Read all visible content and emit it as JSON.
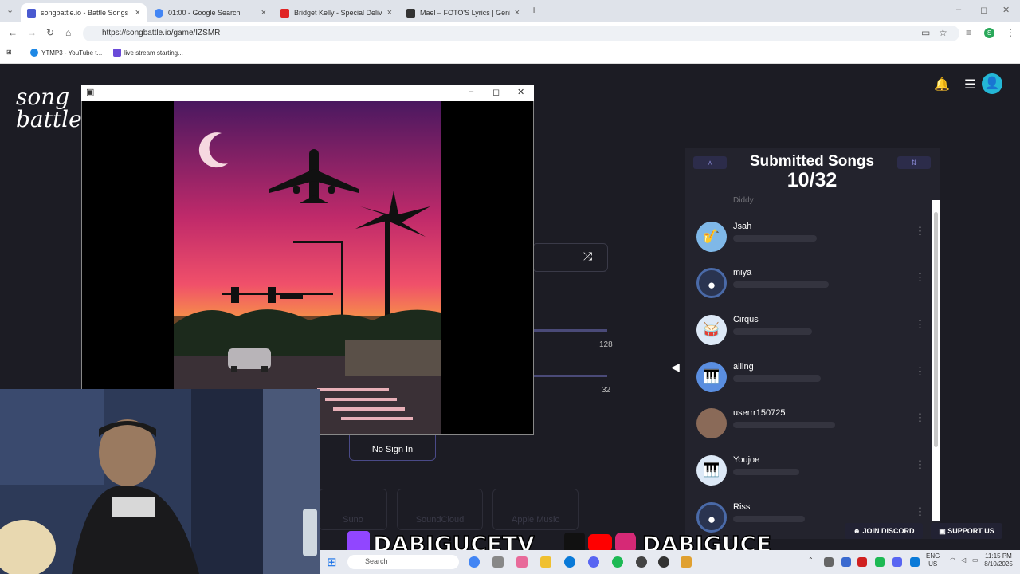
{
  "tabs": [
    {
      "title": "songbattle.io - Battle Songs ag",
      "color": "#4a5ad0",
      "active": true
    },
    {
      "title": "01:00 - Google Search",
      "color": "#4285f4",
      "active": false
    },
    {
      "title": "Bridget Kelly - Special Delivery",
      "color": "#e02424",
      "active": false
    },
    {
      "title": "Mael – FOTO'S Lyrics | Genius L",
      "color": "#333333",
      "active": false
    }
  ],
  "browser": {
    "url": "https://songbattle.io/game/IZSMR",
    "bookmarks": [
      "YTMP3 - YouTube t...",
      "live stream starting..."
    ],
    "new_tab": "+"
  },
  "site": {
    "logo_line1": "song",
    "logo_line2": "battle.",
    "panel_title": "Submitted Songs",
    "panel_count": "10/32",
    "slider1_value": "128",
    "slider2_value": "32",
    "sign_in_label": "No Sign In",
    "services": [
      "Suno",
      "SoundCloud",
      "Apple Music"
    ]
  },
  "songs": [
    {
      "name": "Jsah",
      "icon": "saxophone-icon",
      "glyph": "🎷"
    },
    {
      "name": "miya",
      "icon": "vinyl-icon",
      "glyph": "●"
    },
    {
      "name": "Cirqus",
      "icon": "drums-icon",
      "glyph": "🥁"
    },
    {
      "name": "aiiing",
      "icon": "keyboard-icon",
      "glyph": "🎹"
    },
    {
      "name": "userrr150725",
      "icon": "user-photo-icon",
      "glyph": ""
    },
    {
      "name": "Youjoe",
      "icon": "piano-icon",
      "glyph": "🎹"
    },
    {
      "name": "Riss",
      "icon": "vinyl-icon",
      "glyph": "●"
    }
  ],
  "ghost_song": "Diddy",
  "stream": {
    "banner_left": "DABIGUCETV",
    "banner_right": "DABIGUCE",
    "join_discord": "JOIN DISCORD",
    "support_us": "SUPPORT US"
  },
  "taskbar": {
    "search_placeholder": "Search",
    "lang": "ENG",
    "region": "US",
    "time": "11:15 PM",
    "date": "8/10/2025"
  }
}
